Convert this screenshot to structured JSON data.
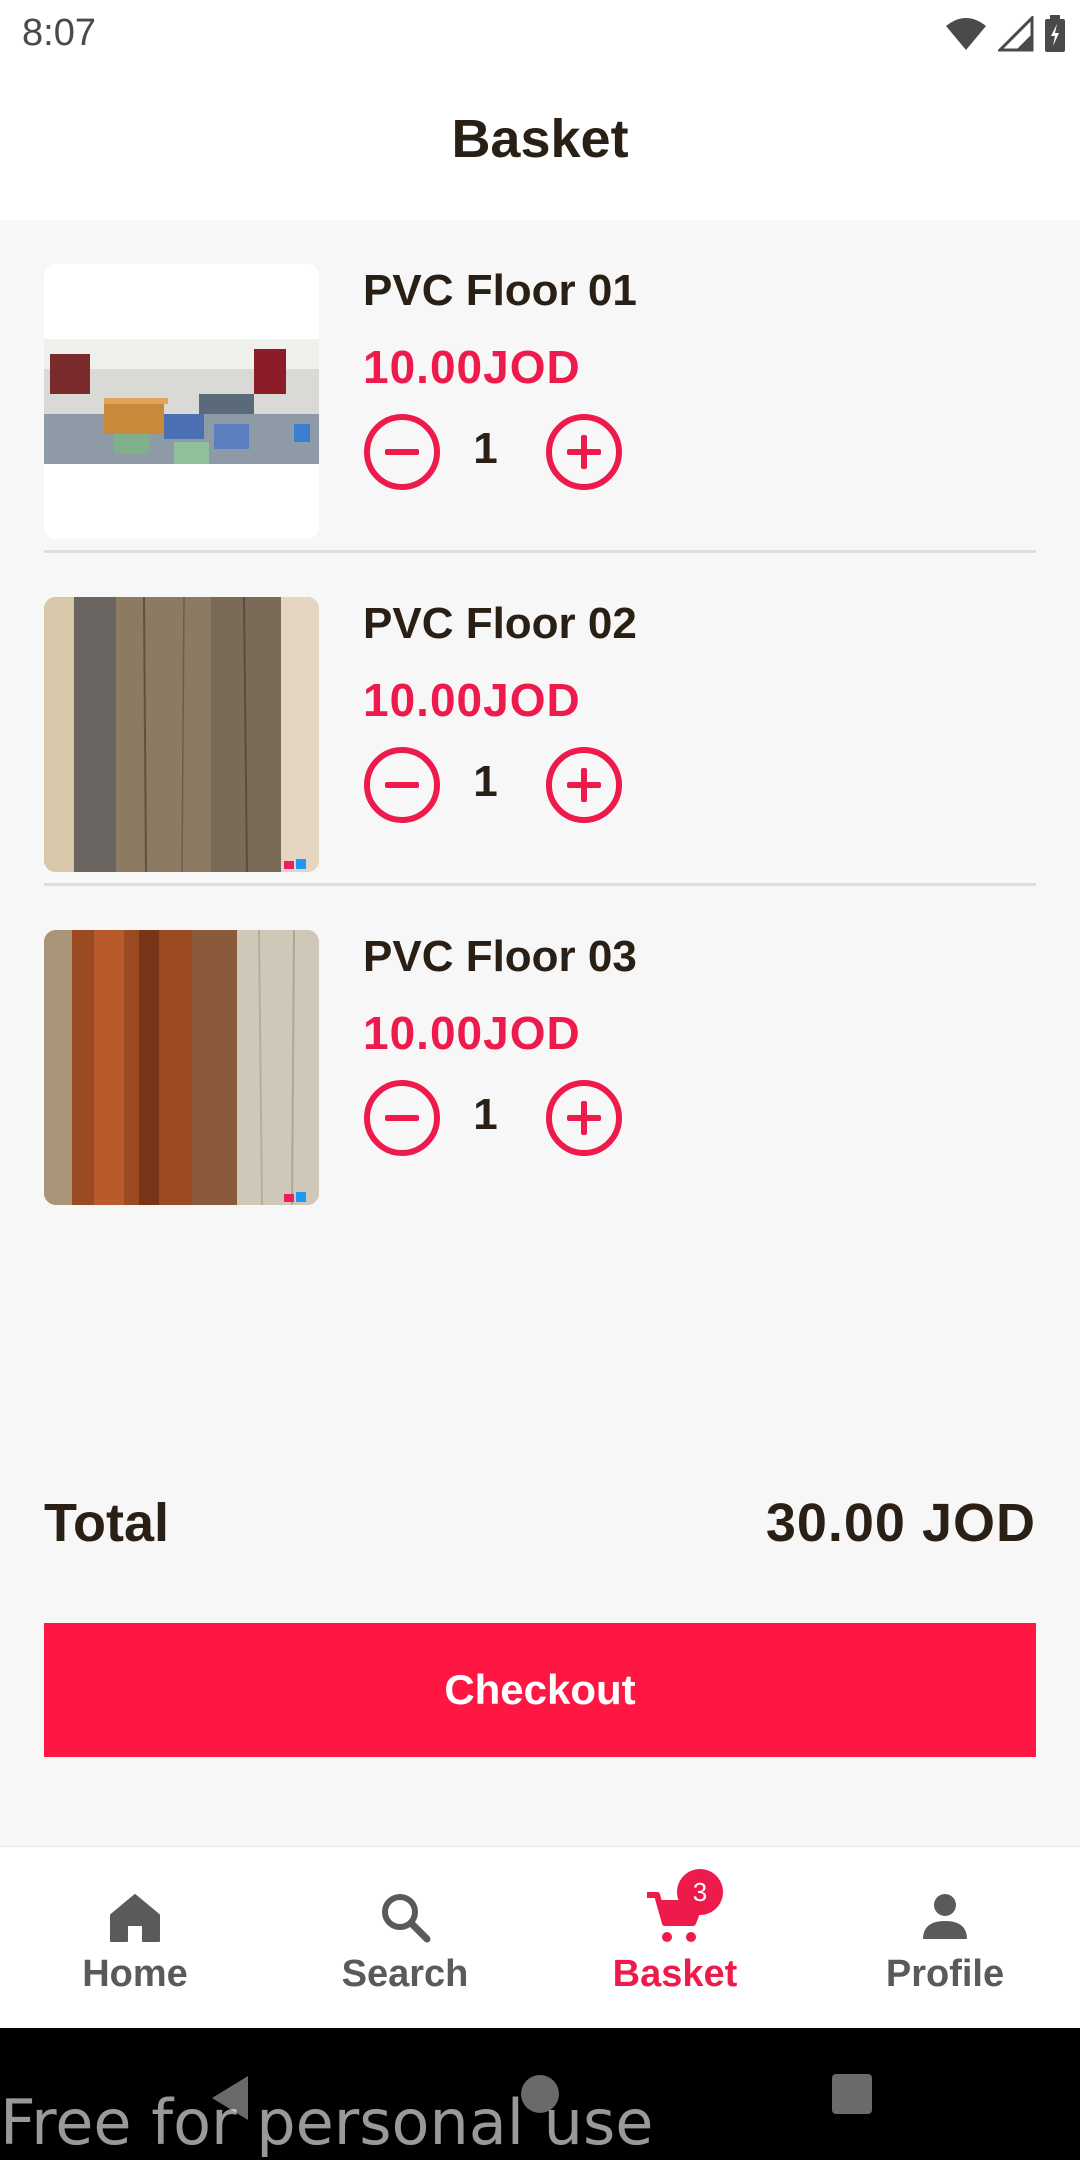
{
  "status_bar": {
    "time": "8:07"
  },
  "header": {
    "title": "Basket"
  },
  "basket": {
    "items": [
      {
        "name": "PVC Floor 01",
        "price": "10.00JOD",
        "quantity": "1"
      },
      {
        "name": "PVC Floor 02",
        "price": "10.00JOD",
        "quantity": "1"
      },
      {
        "name": "PVC Floor 03",
        "price": "10.00JOD",
        "quantity": "1"
      }
    ]
  },
  "summary": {
    "total_label": "Total",
    "total_value": "30.00 JOD"
  },
  "checkout": {
    "label": "Checkout"
  },
  "bottom_nav": {
    "items": [
      {
        "label": "Home",
        "icon": "home-icon"
      },
      {
        "label": "Search",
        "icon": "search-icon"
      },
      {
        "label": "Basket",
        "icon": "cart-icon",
        "badge": "3",
        "active": true
      },
      {
        "label": "Profile",
        "icon": "person-icon"
      }
    ]
  },
  "watermark": "Free for personal use",
  "colors": {
    "accent": "#ee1a4c",
    "checkout_bg": "#ff1744",
    "text_dark": "#2a1f14"
  }
}
